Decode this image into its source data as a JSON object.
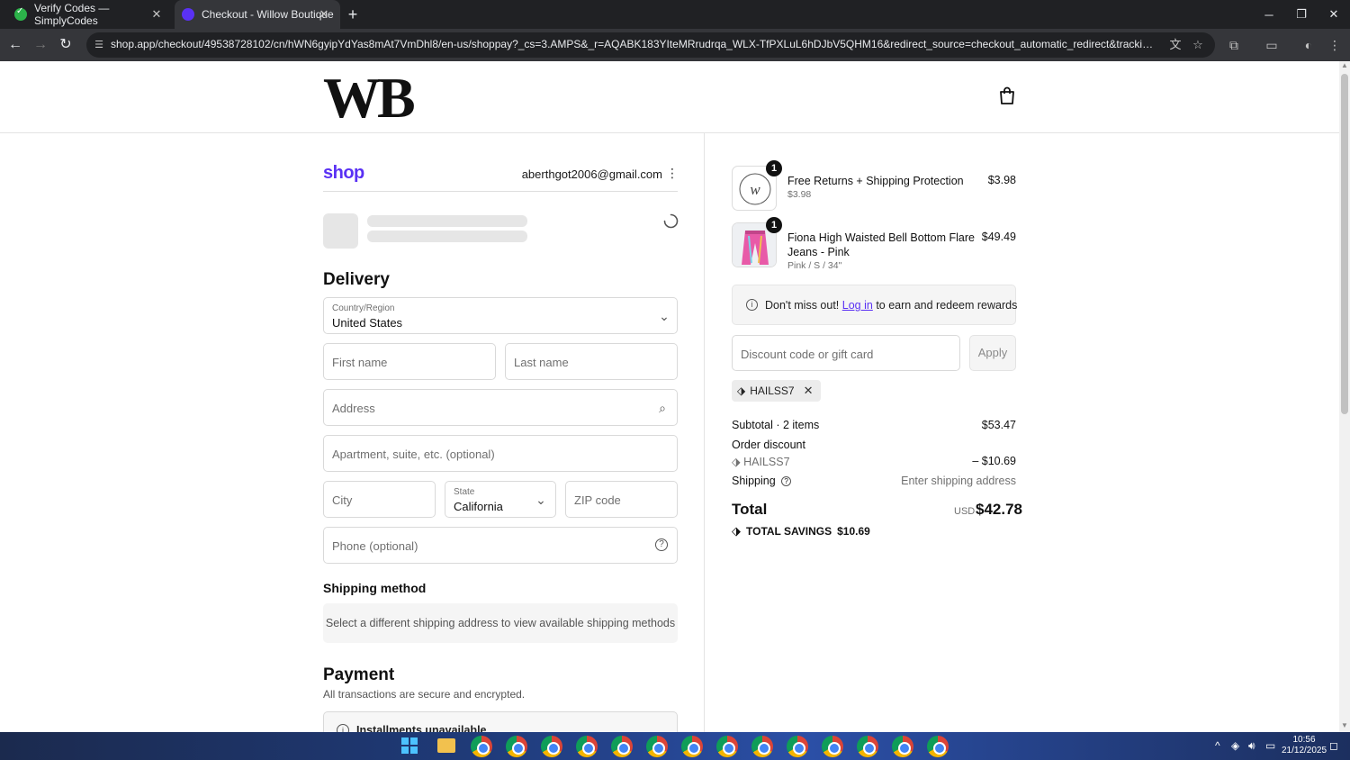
{
  "browser": {
    "tabs": [
      {
        "title": "Verify Codes — SimplyCodes"
      },
      {
        "title": "Checkout - Willow Boutique"
      }
    ],
    "url": "shop.app/checkout/49538728102/cn/hWN6gyipYdYas8mAt7VmDhl8/en-us/shoppay?_cs=3.AMPS&_r=AQABK183YIteMRrudrqa_WLX-TfPXLuL6hDJbV5QHM16&redirect_source=checkout_automatic_redirect&tracking_unique=3b9c065c-015a..."
  },
  "store": {
    "logo": "WB"
  },
  "shop_pay": {
    "logo": "shop",
    "email": "aberthgot2006@gmail.com"
  },
  "delivery": {
    "heading": "Delivery",
    "country_label": "Country/Region",
    "country_value": "United States",
    "first_name_placeholder": "First name",
    "last_name_placeholder": "Last name",
    "address_placeholder": "Address",
    "apartment_placeholder": "Apartment, suite, etc. (optional)",
    "city_placeholder": "City",
    "state_label": "State",
    "state_value": "California",
    "zip_placeholder": "ZIP code",
    "phone_placeholder": "Phone (optional)"
  },
  "shipping_method": {
    "heading": "Shipping method",
    "message": "Select a different shipping address to view available shipping methods"
  },
  "payment": {
    "heading": "Payment",
    "subtext": "All transactions are secure and encrypted.",
    "installments": "Installments unavailable"
  },
  "order": {
    "items": [
      {
        "qty": "1",
        "name": "Free Returns + Shipping Protection",
        "variant": "$3.98",
        "price": "$3.98"
      },
      {
        "qty": "1",
        "name": "Fiona High Waisted Bell Bottom Flare Jeans - Pink",
        "variant": "Pink / S / 34\"",
        "price": "$49.49"
      }
    ],
    "rewards_prefix": "Don't miss out!",
    "rewards_link": "Log in",
    "rewards_suffix": "to earn and redeem rewards",
    "discount_placeholder": "Discount code or gift card",
    "apply_label": "Apply",
    "applied_code": "HAILSS7",
    "subtotal_label": "Subtotal · 2 items",
    "subtotal_value": "$53.47",
    "order_discount_label": "Order discount",
    "discount_code": "HAILSS7",
    "discount_value": "– $10.69",
    "shipping_label": "Shipping",
    "shipping_value": "Enter shipping address",
    "total_label": "Total",
    "total_currency": "USD",
    "total_value": "$42.78",
    "savings_label": "TOTAL SAVINGS",
    "savings_value": "$10.69"
  },
  "taskbar": {
    "time": "10:56",
    "date": "21/12/2025"
  },
  "colors": {
    "shop_purple": "#5a31f4",
    "chrome_dark": "#202124",
    "chrome_toolbar": "#35363a"
  }
}
